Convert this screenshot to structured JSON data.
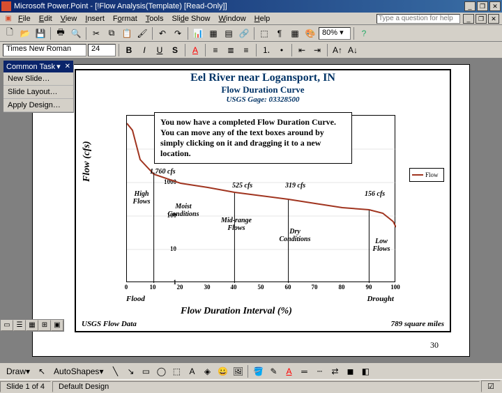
{
  "titlebar": {
    "app": "Microsoft Power.Point",
    "doc": "[!Flow Analysis(Template) [Read-Only]]"
  },
  "menubar": {
    "items": [
      "File",
      "Edit",
      "View",
      "Insert",
      "Format",
      "Tools",
      "Slide Show",
      "Window",
      "Help"
    ],
    "help_placeholder": "Type a question for help"
  },
  "toolbar1": {
    "zoom": "80%"
  },
  "toolbar2": {
    "font": "Times New Roman",
    "size": "24"
  },
  "taskpane": {
    "header": "Common Task",
    "items": [
      "New Slide…",
      "Slide Layout…",
      "Apply Design…"
    ]
  },
  "callout": {
    "text": "You now have a completed Flow Duration Curve.  You can move any of the text boxes around by simply clicking on it and dragging it to a new location."
  },
  "chart": {
    "title": "Eel River near Logansport, IN",
    "subtitle": "Flow Duration Curve",
    "gage": "USGS Gage:  03328500",
    "ylabel": "Flow (cfs)",
    "xlabel": "Flow Duration Interval (%)",
    "foot_left": "Flood",
    "foot_right": "Drought",
    "bottom_left": "USGS Flow Data",
    "bottom_right": "789 square miles",
    "legend": "Flow",
    "regions": [
      "High Flows",
      "Moist Conditions",
      "Mid-range Flows",
      "Dry Conditions",
      "Low Flows"
    ],
    "value_labels": [
      "1,760 cfs",
      "525 cfs",
      "319 cfs",
      "156 cfs"
    ]
  },
  "chart_data": {
    "type": "line",
    "title": "Eel River near Logansport, IN — Flow Duration Curve",
    "xlabel": "Flow Duration Interval (%)",
    "ylabel": "Flow (cfs)",
    "x_scale": "linear",
    "y_scale": "log",
    "xlim": [
      0,
      100
    ],
    "ylim": [
      1,
      100000
    ],
    "x": [
      0,
      2,
      5,
      10,
      20,
      30,
      40,
      50,
      60,
      70,
      80,
      90,
      95,
      99,
      100
    ],
    "values": [
      60000,
      15000,
      5000,
      1760,
      950,
      700,
      525,
      400,
      319,
      240,
      180,
      156,
      120,
      70,
      50
    ],
    "region_dividers_x": [
      10,
      40,
      60,
      90
    ],
    "region_divider_values_cfs": [
      1760,
      525,
      319,
      156
    ],
    "region_names": [
      "High Flows",
      "Moist Conditions",
      "Mid-range Flows",
      "Dry Conditions",
      "Low Flows"
    ],
    "series": [
      {
        "name": "Flow",
        "color": "#a0341f"
      }
    ]
  },
  "page_num": "30",
  "drawbar": {
    "label": "Draw",
    "autoshapes": "AutoShapes"
  },
  "status": {
    "slide": "Slide 1 of 4",
    "design": "Default Design"
  }
}
